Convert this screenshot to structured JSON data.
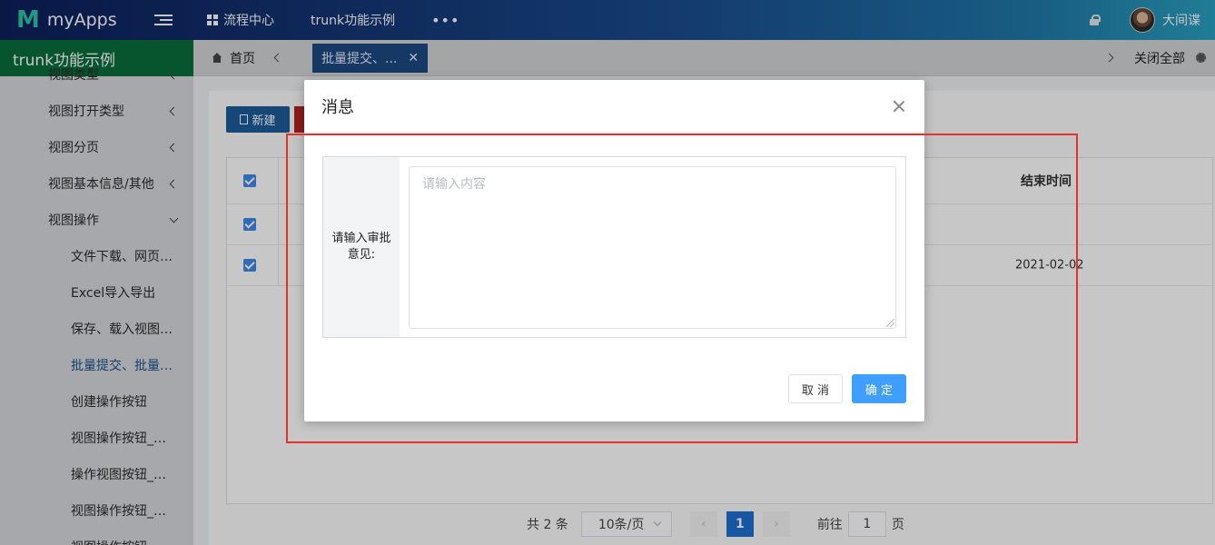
{
  "header": {
    "logo_mark": "M",
    "app_name": "myApps",
    "nav": [
      {
        "label": "流程中心"
      },
      {
        "label": "trunk功能示例"
      }
    ],
    "more": "•••",
    "username": "大间谍"
  },
  "sidebar": {
    "title": "trunk功能示例",
    "items": [
      {
        "label": "视图类型",
        "indicator": "chevron-left"
      },
      {
        "label": "视图打开类型",
        "indicator": "chevron-left"
      },
      {
        "label": "视图分页",
        "indicator": "chevron-left"
      },
      {
        "label": "视图基本信息/其他",
        "indicator": "chevron-left"
      },
      {
        "label": "视图操作",
        "indicator": "chevron-down"
      }
    ],
    "subitems": [
      {
        "label": "文件下载、网页打印..."
      },
      {
        "label": "Excel导入导出"
      },
      {
        "label": "保存、载入视图、清..."
      },
      {
        "label": "批量提交、批量签章..."
      },
      {
        "label": "创建操作按钮"
      },
      {
        "label": "视图操作按钮_执行..."
      },
      {
        "label": "操作视图按钮_操作..."
      },
      {
        "label": "视图操作按钮_按钮..."
      },
      {
        "label": "视图操作按钮_视图..."
      }
    ],
    "active_subitem": "批量提交、批量签章..."
  },
  "tabs": {
    "home": "首页",
    "active": "批量提交、...",
    "active_close": "✕",
    "close_all": "关闭全部"
  },
  "content": {
    "new_button": "新建",
    "table": {
      "end_time_header": "结束时间",
      "rows": [
        {
          "end_time": ""
        },
        {
          "end_time": "2021-02-02"
        }
      ]
    },
    "pagination": {
      "total": "共 2 条",
      "page_size": "10条/页",
      "prev": "‹",
      "current_page": "1",
      "next": "›",
      "goto_label": "前往",
      "goto_value": "1",
      "page_suffix": "页"
    }
  },
  "dialog": {
    "title": "消息",
    "field_label": "请输入审批意见:",
    "placeholder": "请输入内容",
    "cancel": "取 消",
    "confirm": "确 定"
  },
  "colors": {
    "accent": "#409eff",
    "sidebar_title_bg": "#0a6d3c",
    "annotation": "#e8302a"
  }
}
